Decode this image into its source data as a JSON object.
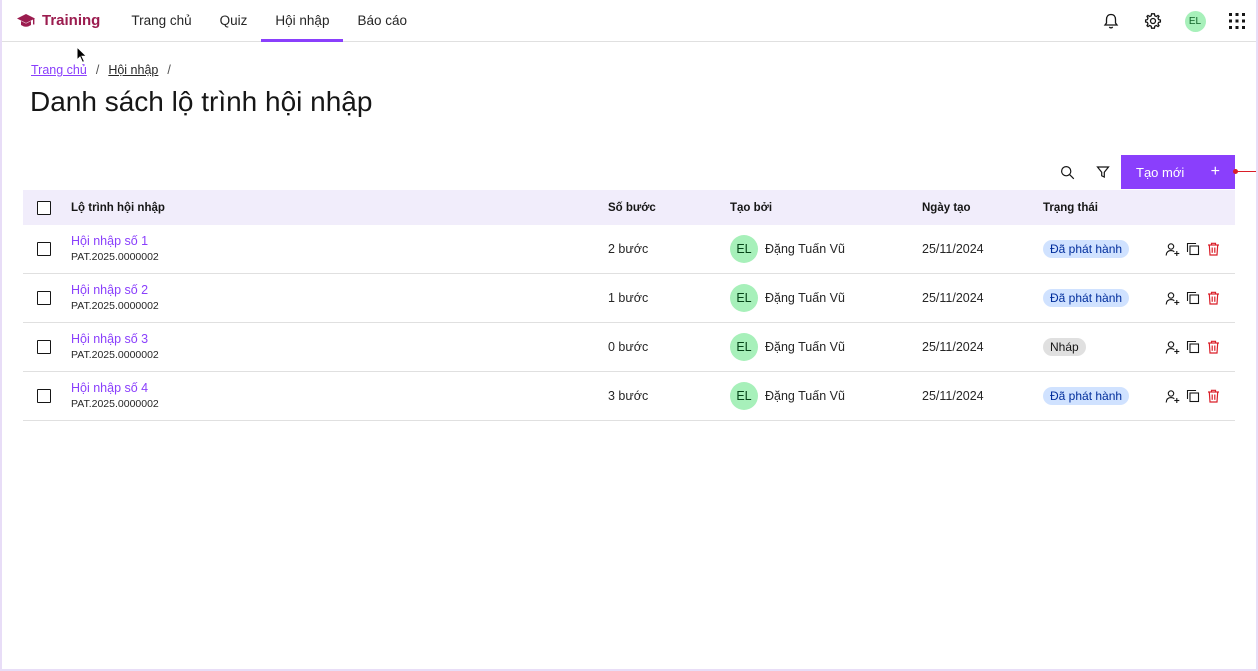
{
  "header": {
    "brand": "Training",
    "nav": [
      {
        "label": "Trang chủ",
        "active": false
      },
      {
        "label": "Quiz",
        "active": false
      },
      {
        "label": "Hội nhập",
        "active": true
      },
      {
        "label": "Báo cáo",
        "active": false
      }
    ],
    "icons": [
      "bell-icon",
      "gear-icon",
      "app-grid-icon"
    ],
    "user_initials": "EL"
  },
  "breadcrumb": [
    {
      "label": "Trang chủ"
    },
    {
      "label": "Hội nhập"
    }
  ],
  "page_title": "Danh sách lộ trình hội nhập",
  "toolbar": {
    "create_label": "Tạo mới",
    "create_icon": "+"
  },
  "table": {
    "columns": [
      "Lộ trình hội nhập",
      "Số bước",
      "Tạo bởi",
      "Ngày tạo",
      "Trạng thái"
    ],
    "rows": [
      {
        "name": "Hội nhập số 1",
        "code": "PAT.2025.0000002",
        "steps": "2 bước",
        "creator_initials": "EL",
        "creator": "Đặng Tuấn Vũ",
        "date": "25/11/2024",
        "status": "Đã phát hành",
        "status_type": "published"
      },
      {
        "name": "Hội nhập số 2",
        "code": "PAT.2025.0000002",
        "steps": "1 bước",
        "creator_initials": "EL",
        "creator": "Đặng Tuấn Vũ",
        "date": "25/11/2024",
        "status": "Đã phát hành",
        "status_type": "published"
      },
      {
        "name": "Hội nhập số 3",
        "code": "PAT.2025.0000002",
        "steps": "0 bước",
        "creator_initials": "EL",
        "creator": "Đặng Tuấn Vũ",
        "date": "25/11/2024",
        "status": "Nháp",
        "status_type": "draft"
      },
      {
        "name": "Hội nhập số 4",
        "code": "PAT.2025.0000002",
        "steps": "3 bước",
        "creator_initials": "EL",
        "creator": "Đặng Tuấn Vũ",
        "date": "25/11/2024",
        "status": "Đã phát hành",
        "status_type": "published"
      }
    ]
  },
  "colors": {
    "accent": "#8a3ffc",
    "brand": "#9b1c4f",
    "delete": "#da1e28"
  }
}
